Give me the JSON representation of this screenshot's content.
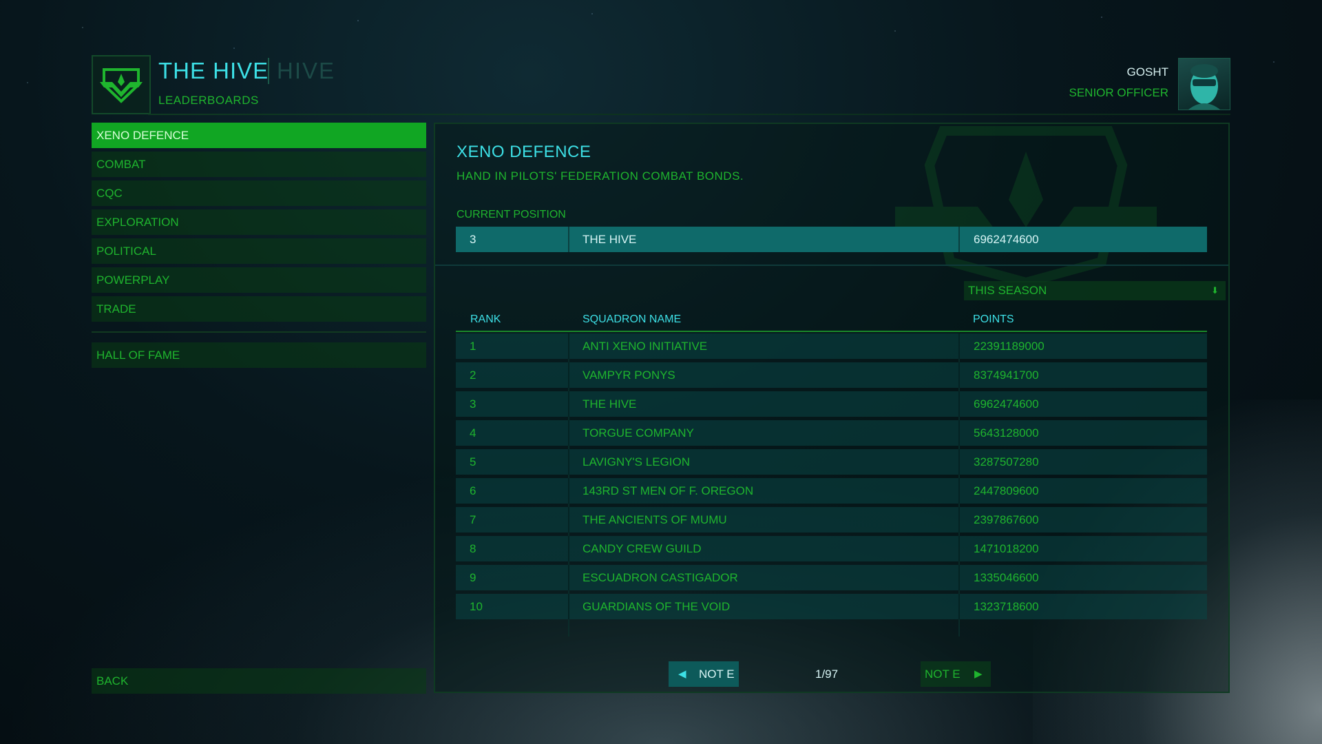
{
  "header": {
    "squadron_name": "THE HIVE",
    "squadron_tag": "HIVE",
    "section": "LEADERBOARDS",
    "commander": "GOSHT",
    "commander_rank": "SENIOR OFFICER"
  },
  "sidebar": {
    "items": [
      {
        "label": "XENO DEFENCE",
        "active": true
      },
      {
        "label": "COMBAT"
      },
      {
        "label": "CQC"
      },
      {
        "label": "EXPLORATION"
      },
      {
        "label": "POLITICAL"
      },
      {
        "label": "POWERPLAY"
      },
      {
        "label": "TRADE"
      }
    ],
    "hall_of_fame": "HALL OF FAME",
    "back": "BACK"
  },
  "board": {
    "title": "XENO DEFENCE",
    "description": "HAND IN PILOTS' FEDERATION COMBAT BONDS.",
    "current_label": "CURRENT POSITION",
    "current": {
      "rank": "3",
      "name": "THE HIVE",
      "points": "6962474600"
    },
    "period": "THIS SEASON",
    "columns": {
      "rank": "RANK",
      "name": "SQUADRON NAME",
      "points": "POINTS"
    },
    "rows": [
      {
        "rank": "1",
        "name": "ANTI XENO INITIATIVE",
        "points": "22391189000"
      },
      {
        "rank": "2",
        "name": "VAMPYR PONYS",
        "points": "8374941700"
      },
      {
        "rank": "3",
        "name": "THE HIVE",
        "points": "6962474600"
      },
      {
        "rank": "4",
        "name": "TORGUE COMPANY",
        "points": "5643128000"
      },
      {
        "rank": "5",
        "name": "LAVIGNY'S LEGION",
        "points": "3287507280"
      },
      {
        "rank": "6",
        "name": "143RD ST MEN OF F. OREGON",
        "points": "2447809600"
      },
      {
        "rank": "7",
        "name": "THE ANCIENTS OF MUMU",
        "points": "2397867600"
      },
      {
        "rank": "8",
        "name": "CANDY CREW GUILD",
        "points": "1471018200"
      },
      {
        "rank": "9",
        "name": "ESCUADRON CASTIGADOR",
        "points": "1335046600"
      },
      {
        "rank": "10",
        "name": "GUARDIANS OF THE VOID",
        "points": "1323718600"
      }
    ],
    "pager": {
      "prev": "NOT E",
      "next": "NOT E",
      "count": "1/97"
    }
  }
}
